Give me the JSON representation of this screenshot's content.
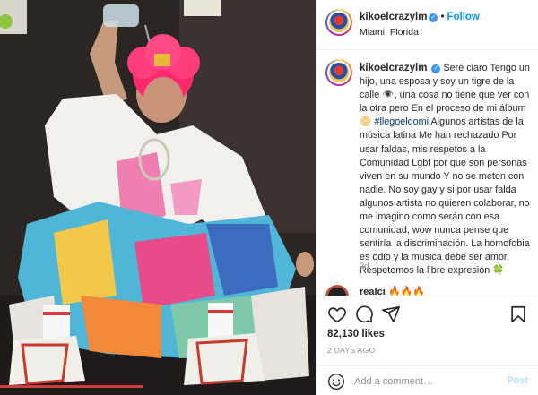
{
  "header": {
    "username": "kikoelcrazylm",
    "separator": "•",
    "follow_label": "Follow",
    "location": "Miami, Florida"
  },
  "caption": {
    "username": "kikoelcrazylm",
    "text_part1": "Seré claro Tengo un hijo, una esposa y soy un tigre de la calle 👁️, una cosa no tiene que ver con la otra pero En el proceso de mi álbum 📀",
    "hashtag": "#llegoeldomi",
    "text_part2": "Algunos artistas de la música latina Me han rechazado Por usar faldas, mis respetos a la Comunidad Lgbt por que son personas viven en su mundo Y no se meten con nadie. No soy gay y si por usar falda algunos artista no quieren colaborar, no me imagino como serán con esa comunidad, wow nunca pense que sentiría la discriminación. La homofobia es odio y la musica debe ser amor. Respetemos la libre expresión 🍀",
    "age": "2d"
  },
  "next_comment": {
    "username": "realci",
    "text": "🔥🔥🔥"
  },
  "stats": {
    "likes": "82,130 likes",
    "timestamp": "2 DAYS AGO"
  },
  "comment_box": {
    "placeholder": "Add a comment…",
    "post_label": "Post"
  },
  "colors": {
    "link_blue": "#0095f6",
    "hair": "#ff2a6d",
    "post_disabled": "#b2dffc"
  },
  "icons": [
    "heart-icon",
    "comment-icon",
    "share-icon",
    "bookmark-icon",
    "emoji-icon",
    "verified-icon"
  ]
}
